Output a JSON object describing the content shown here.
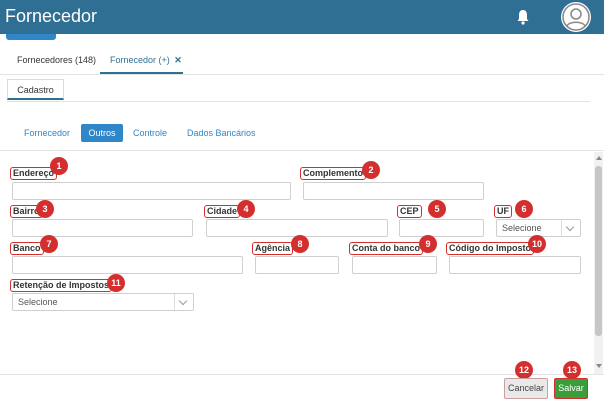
{
  "header": {
    "title": "Fornecedor"
  },
  "tabs": [
    {
      "label": "Fornecedores (148)"
    },
    {
      "label": "Fornecedor (+)"
    }
  ],
  "subtab": {
    "label": "Cadastro"
  },
  "sections": [
    {
      "label": "Fornecedor"
    },
    {
      "label": "Outros"
    },
    {
      "label": "Controle"
    },
    {
      "label": "Dados Bancários"
    }
  ],
  "fields": {
    "endereco": {
      "label": "Endereço",
      "badge": "1"
    },
    "complemento": {
      "label": "Complemento",
      "badge": "2"
    },
    "bairro": {
      "label": "Bairro",
      "badge": "3"
    },
    "cidade": {
      "label": "Cidade",
      "badge": "4"
    },
    "cep": {
      "label": "CEP",
      "badge": "5"
    },
    "uf": {
      "label": "UF",
      "badge": "6",
      "value": "Selecione"
    },
    "banco": {
      "label": "Banco",
      "badge": "7"
    },
    "agencia": {
      "label": "Agência",
      "badge": "8"
    },
    "conta": {
      "label": "Conta do banco",
      "badge": "9"
    },
    "codigo_imposto": {
      "label": "Código do Imposto",
      "badge": "10"
    },
    "retencao": {
      "label": "Retenção de Impostos",
      "badge": "11",
      "value": "Selecione"
    }
  },
  "footer": {
    "cancel": {
      "label": "Cancelar",
      "badge": "12"
    },
    "save": {
      "label": "Salvar",
      "badge": "13"
    }
  },
  "colors": {
    "header": "#2f6f94",
    "accent": "#2f86c8",
    "save": "#3a9d3a",
    "annotation": "#d32f2f"
  }
}
